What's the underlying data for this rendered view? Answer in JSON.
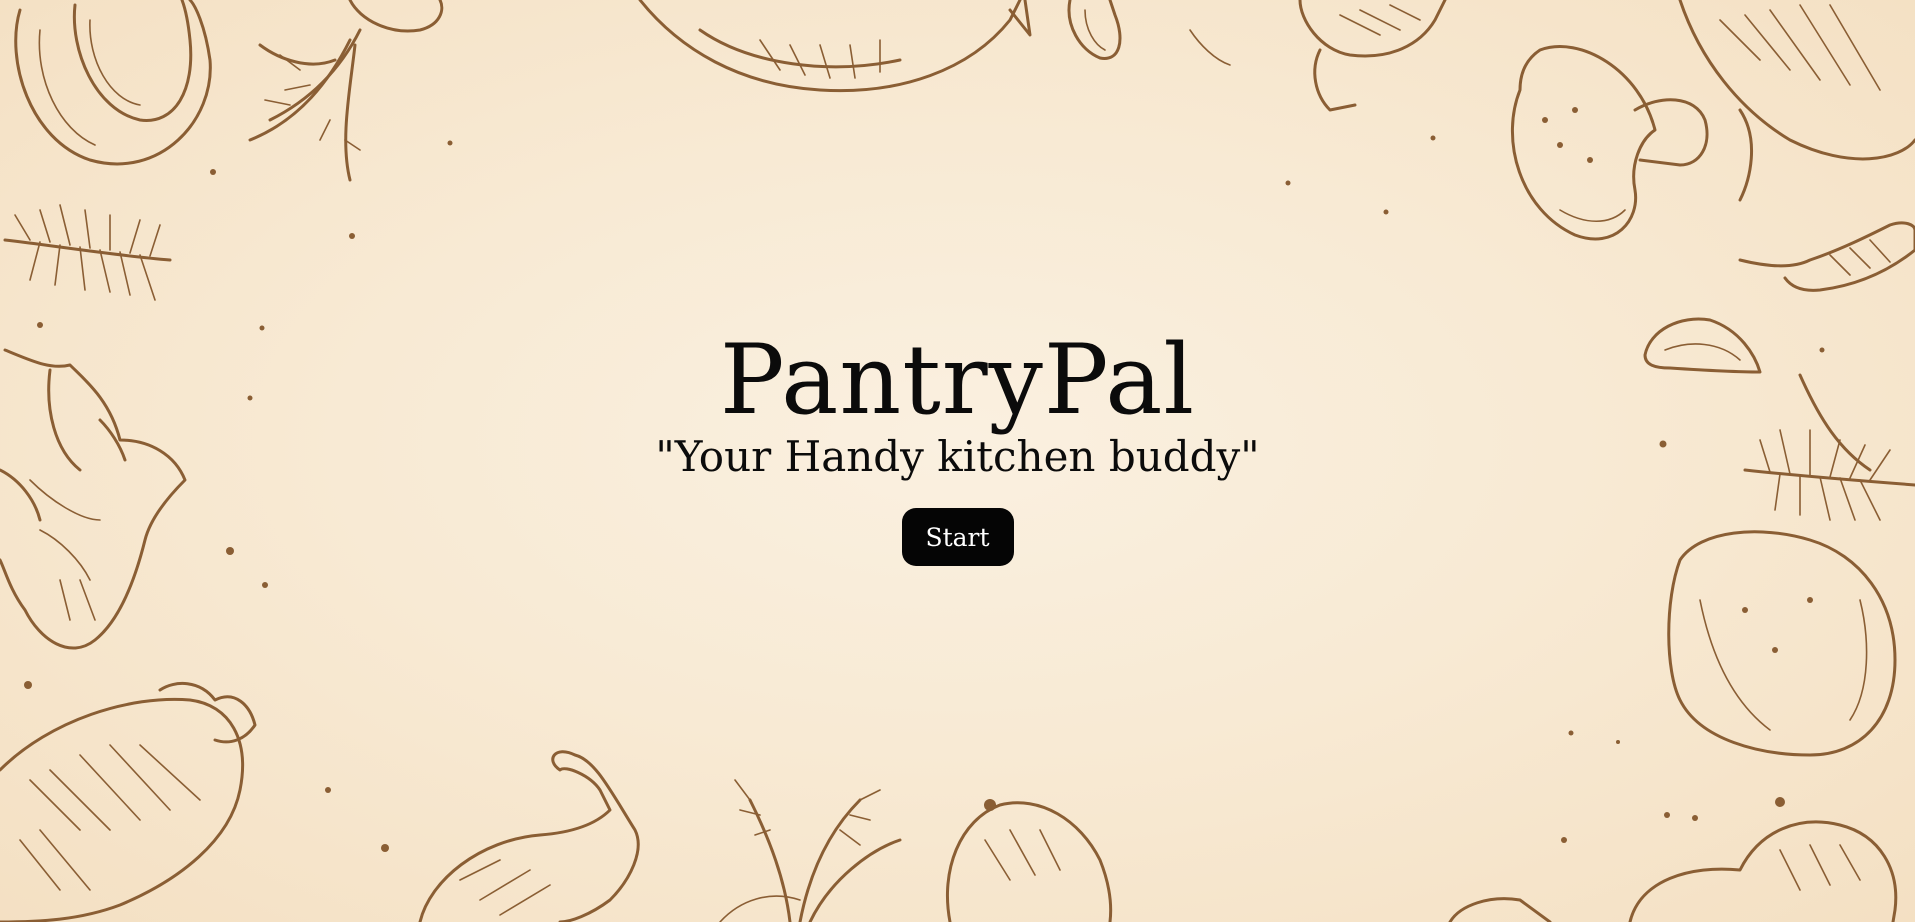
{
  "app": {
    "title": "PantryPal",
    "tagline": "\"Your Handy kitchen buddy\""
  },
  "actions": {
    "start_label": "Start"
  },
  "colors": {
    "background": "#f8ead4",
    "illustration": "#8a5e34",
    "text": "#0b0b0b",
    "button": "#050505",
    "button_text": "#ffffff"
  },
  "illustrations": [
    "avocado-illustration",
    "radish-illustration",
    "fish-illustration",
    "garlic-clove-illustration",
    "mushroom-illustration",
    "leaf-illustration",
    "rosemary-illustration",
    "ginger-illustration",
    "chili-pepper-illustration",
    "lemon-illustration",
    "eggplant-illustration",
    "drumstick-illustration",
    "herb-bunch-illustration",
    "potato-illustration"
  ]
}
